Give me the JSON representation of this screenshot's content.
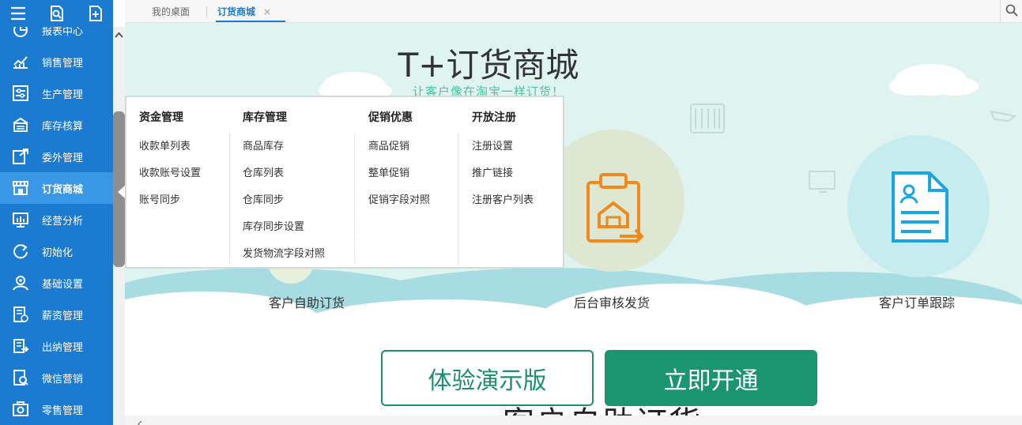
{
  "sidebar": {
    "top_icons": [
      "menu-icon",
      "search-doc-icon",
      "add-doc-icon"
    ],
    "items": [
      {
        "label": "报表中心",
        "icon": "report-icon"
      },
      {
        "label": "销售管理",
        "icon": "sales-chart-icon"
      },
      {
        "label": "生产管理",
        "icon": "production-icon"
      },
      {
        "label": "库存核算",
        "icon": "inventory-icon"
      },
      {
        "label": "委外管理",
        "icon": "outsource-icon"
      },
      {
        "label": "订货商城",
        "icon": "store-icon",
        "active": true
      },
      {
        "label": "经营分析",
        "icon": "analysis-icon"
      },
      {
        "label": "初始化",
        "icon": "init-icon"
      },
      {
        "label": "基础设置",
        "icon": "settings-icon"
      },
      {
        "label": "薪资管理",
        "icon": "payroll-icon"
      },
      {
        "label": "出纳管理",
        "icon": "cashier-icon"
      },
      {
        "label": "微信营销",
        "icon": "wechat-icon"
      },
      {
        "label": "零售管理",
        "icon": "retail-icon"
      }
    ]
  },
  "tabs": [
    {
      "label": "我的桌面"
    },
    {
      "label": "订货商城",
      "active": true,
      "close": "×"
    }
  ],
  "dropdown": {
    "columns": [
      {
        "title": "资金管理",
        "items": [
          "收款单列表",
          "收款账号设置",
          "账号同步"
        ]
      },
      {
        "title": "库存管理",
        "items": [
          "商品库存",
          "仓库列表",
          "仓库同步",
          "库存同步设置",
          "发货物流字段对照"
        ]
      },
      {
        "title": "促销优惠",
        "items": [
          "商品促销",
          "整单促销",
          "促销字段对照"
        ]
      },
      {
        "title": "开放注册",
        "items": [
          "注册设置",
          "推广链接",
          "注册客户列表"
        ]
      }
    ]
  },
  "hero": {
    "title": "T+订货商城",
    "subtitle": "让客户像在淘宝一样订货！"
  },
  "features": [
    {
      "label": "客户自助订货"
    },
    {
      "label": "后台审核发货"
    },
    {
      "label": "客户订单跟踪"
    }
  ],
  "buttons": {
    "demo": "体验演示版",
    "open": "立即开通"
  },
  "bottom_title": "客户自助订货",
  "colors": {
    "sidebar": "#1a7bd0",
    "sidebar_active": "#3a97e6",
    "accent_green": "#1b9470",
    "hero_bg": "#dff4f0"
  }
}
